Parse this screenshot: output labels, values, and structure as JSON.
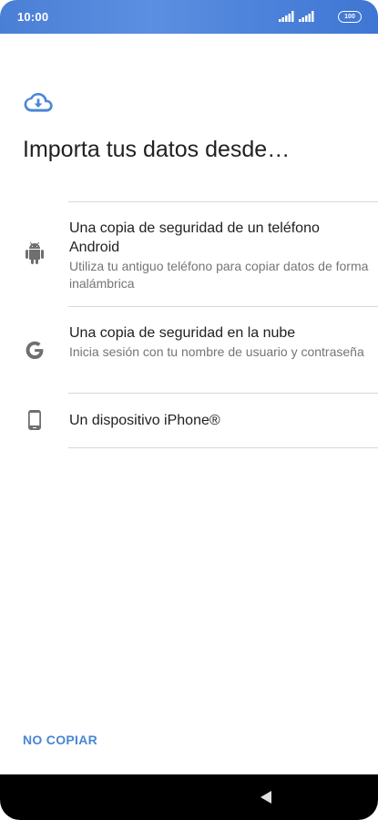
{
  "status_bar": {
    "time": "10:00",
    "battery": "100"
  },
  "screen": {
    "header_icon": "cloud-download-icon",
    "title": "Importa tus datos desde…"
  },
  "options": [
    {
      "icon": "android-icon",
      "title": "Una copia de seguridad de un teléfono Android",
      "subtitle": "Utiliza tu antiguo teléfono para copiar datos de forma inalámbrica"
    },
    {
      "icon": "google-icon",
      "title": "Una copia de seguridad en la nube",
      "subtitle": "Inicia sesión con tu nombre de usuario y contraseña"
    },
    {
      "icon": "smartphone-icon",
      "title": "Un dispositivo iPhone®"
    }
  ],
  "footer": {
    "skip_label": "NO COPIAR"
  },
  "nav_bar": {
    "back_icon": "back-triangle-icon"
  },
  "colors": {
    "status_bar": "#4a7fd6",
    "accent": "#4a86d6",
    "icon_gray": "#6f6f6f"
  }
}
